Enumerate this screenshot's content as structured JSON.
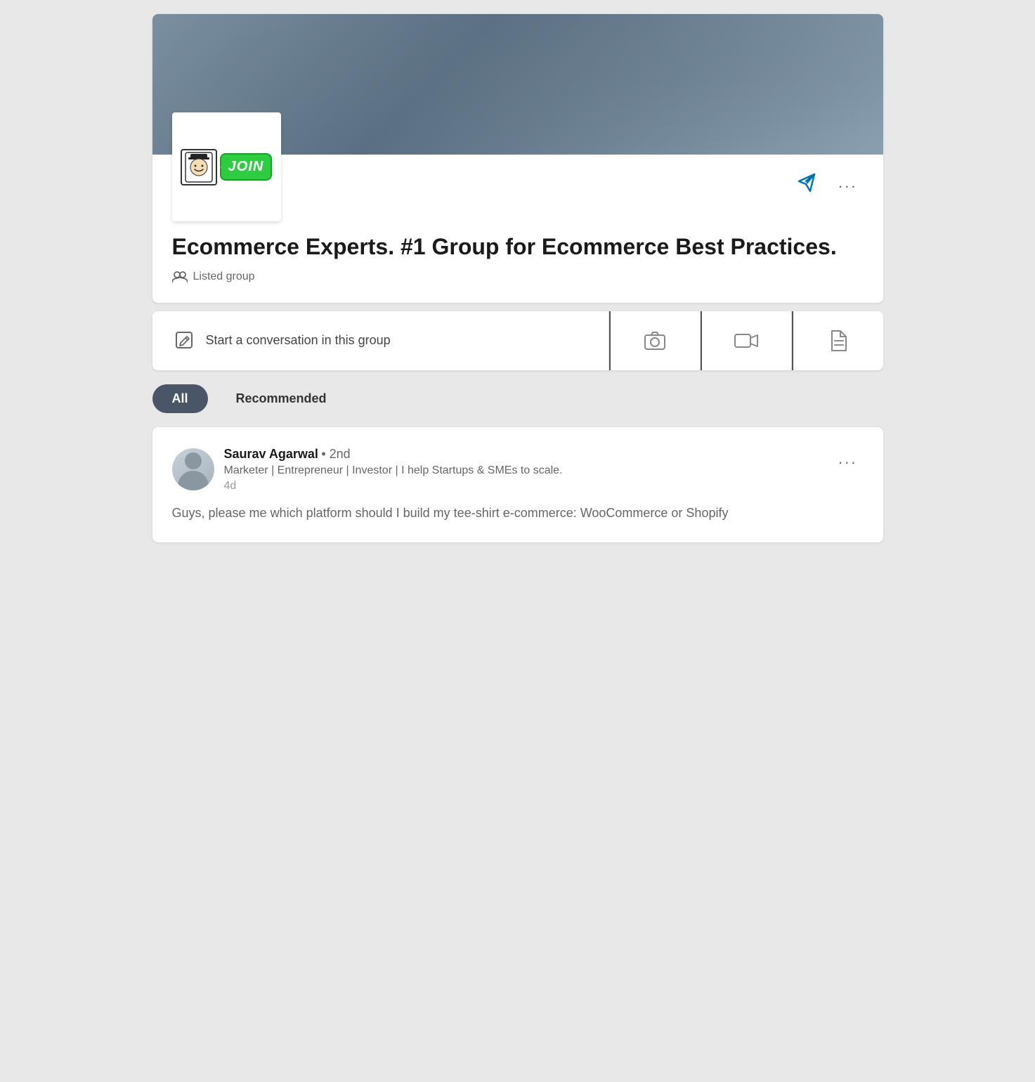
{
  "group": {
    "title": "Ecommerce Experts.  #1 Group for Ecommerce Best Practices.",
    "type": "Listed group",
    "logo_text": "JOIN",
    "cover_alt": "Group cover image"
  },
  "toolbar": {
    "share_label": "Share",
    "more_label": "...",
    "conversation_placeholder": "Start a conversation in this group",
    "photo_label": "Photo",
    "video_label": "Video",
    "document_label": "Document"
  },
  "filters": {
    "all_label": "All",
    "recommended_label": "Recommended"
  },
  "post": {
    "author_name": "Saurav Agarwal",
    "author_degree": "• 2nd",
    "author_bio": "Marketer | Entrepreneur | Investor | I help Startups & SMEs to scale.",
    "time": "4d",
    "content": "Guys, please me which platform should I build my tee-shirt e-commerce:\nWooCommerce or Shopify",
    "more_label": "..."
  },
  "colors": {
    "accent_blue": "#0073b1",
    "dark_tab": "#4a5568",
    "light_tab": "#e8e8e8",
    "text_dark": "#1a1a1a",
    "text_medium": "#666666",
    "text_light": "#999999",
    "border": "#e0e0e0",
    "cover_bg": "#7a8fa0"
  }
}
